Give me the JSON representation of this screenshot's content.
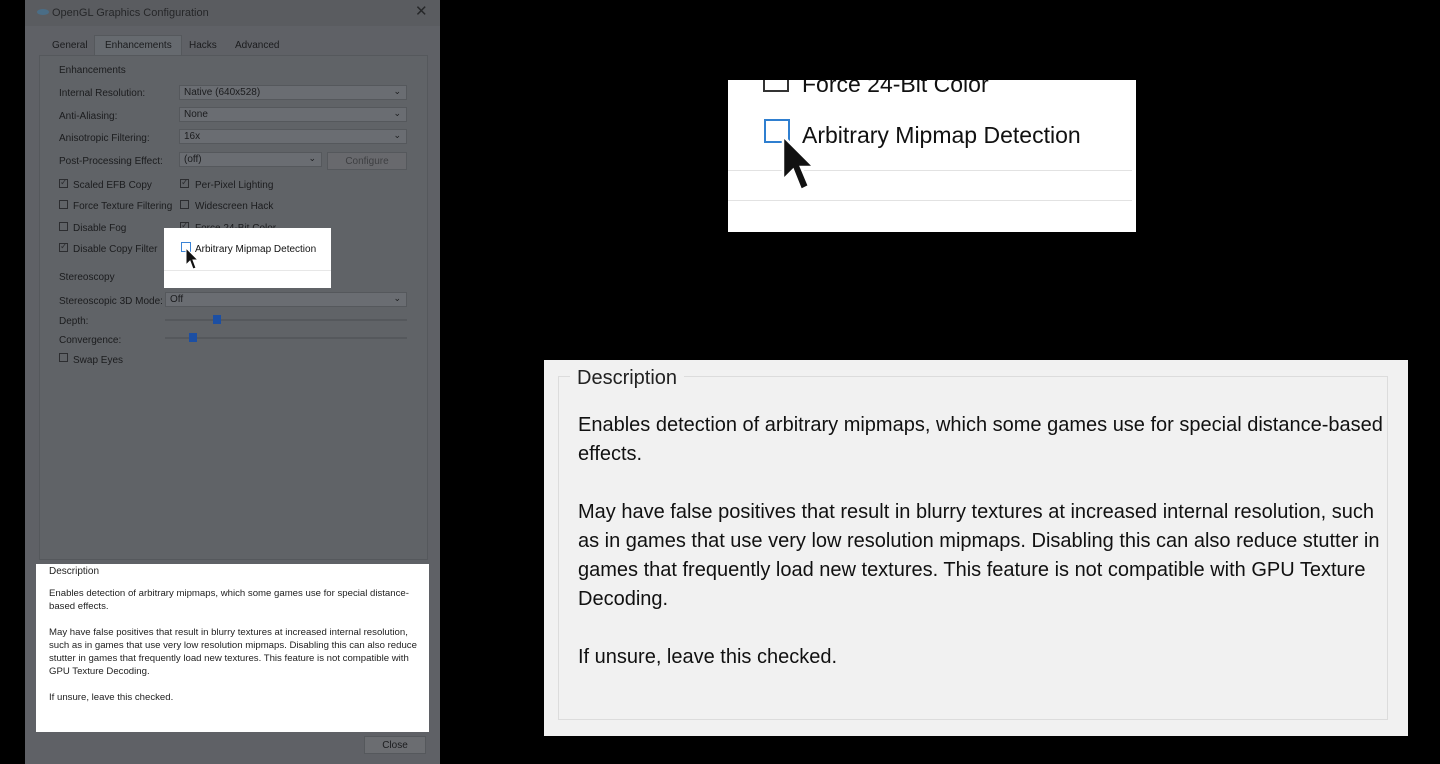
{
  "window": {
    "title": "OpenGL Graphics Configuration"
  },
  "tabs": [
    {
      "label": "General"
    },
    {
      "label": "Enhancements"
    },
    {
      "label": "Hacks"
    },
    {
      "label": "Advanced"
    }
  ],
  "enhancements": {
    "section_label": "Enhancements",
    "internal_resolution": {
      "label": "Internal Resolution:",
      "value": "Native (640x528)"
    },
    "anti_aliasing": {
      "label": "Anti-Aliasing:",
      "value": "None"
    },
    "anisotropic": {
      "label": "Anisotropic Filtering:",
      "value": "16x"
    },
    "post_processing": {
      "label": "Post-Processing Effect:",
      "value": "(off)",
      "configure_label": "Configure"
    },
    "checkboxes": {
      "scaled_efb": {
        "label": "Scaled EFB Copy",
        "checked": true
      },
      "per_pixel": {
        "label": "Per-Pixel Lighting",
        "checked": true
      },
      "force_texture": {
        "label": "Force Texture Filtering",
        "checked": false
      },
      "widescreen": {
        "label": "Widescreen Hack",
        "checked": false
      },
      "disable_fog": {
        "label": "Disable Fog",
        "checked": false
      },
      "force_24bit": {
        "label": "Force 24-Bit Color",
        "checked": true
      },
      "disable_copy": {
        "label": "Disable Copy Filter",
        "checked": true
      },
      "arbitrary_mipmap": {
        "label": "Arbitrary Mipmap Detection",
        "checked": false
      }
    }
  },
  "stereoscopy": {
    "section_label": "Stereoscopy",
    "mode": {
      "label": "Stereoscopic 3D Mode:",
      "value": "Off"
    },
    "depth": {
      "label": "Depth:",
      "level": 0.2
    },
    "convergence": {
      "label": "Convergence:",
      "level": 0.1
    },
    "swap_eyes": {
      "label": "Swap Eyes",
      "checked": false
    }
  },
  "description": {
    "legend": "Description",
    "para1": "Enables detection of arbitrary mipmaps, which some games use for special distance-based effects.",
    "para2": "May have false positives that result in blurry textures at increased internal resolution, such as in games that use very low resolution mipmaps. Disabling this can also reduce stutter in games that frequently load new textures. This feature is not compatible with GPU Texture Decoding.",
    "para3": "If unsure, leave this checked."
  },
  "zoom": {
    "prev_label": "Force 24-Bit Color",
    "checkbox_label": "Arbitrary Mipmap Detection",
    "desc_legend": "Description",
    "desc_para1": "Enables detection of arbitrary mipmaps, which some games use for special distance-based effects.",
    "desc_para2": "May have false positives that result in blurry textures at increased internal resolution, such as in games that use very low resolution mipmaps. Disabling this can also reduce stutter in games that frequently load new textures. This feature is not compatible with GPU Texture Decoding.",
    "desc_para3": "If unsure, leave this checked."
  },
  "buttons": {
    "close_label": "Close"
  },
  "icons": {
    "app": "app-icon",
    "close": "close-icon",
    "cursor": "mouse-cursor-icon"
  },
  "colors": {
    "accent": "#2f7fd0",
    "slider": "#1c4fa3"
  }
}
